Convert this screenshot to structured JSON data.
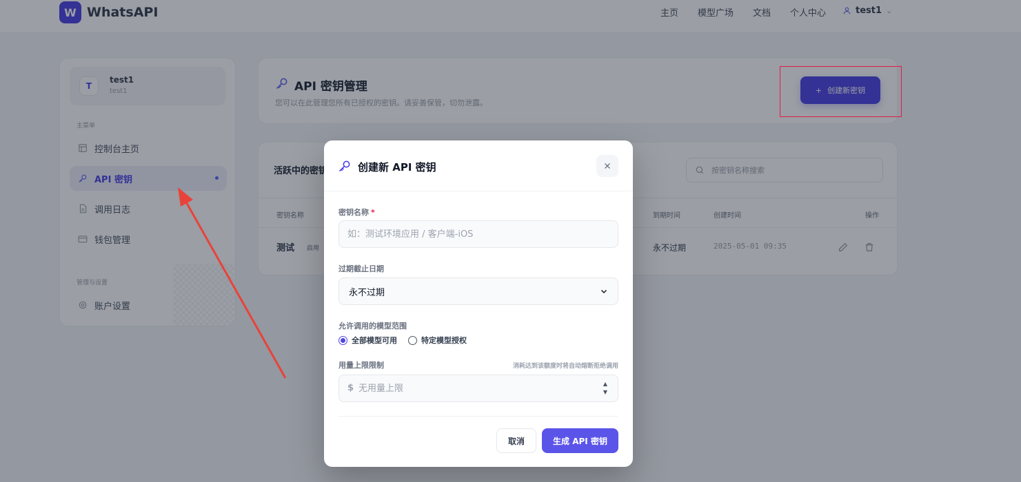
{
  "colors": {
    "accent": "#4f46e5",
    "required": "#e11d48",
    "annotation": "#e8433a"
  },
  "app": {
    "logo_letter": "W",
    "name": "WhatsAPI",
    "nav": [
      "主页",
      "模型广场",
      "文档",
      "个人中心"
    ],
    "user": "test1"
  },
  "sidebar": {
    "avatar_letter": "T",
    "user_name": "test1",
    "user_sub": "test1",
    "section_main": "主菜单",
    "items": [
      {
        "label": "控制台主页",
        "icon": "dashboard-icon"
      },
      {
        "label": "API 密钥",
        "icon": "key-icon"
      },
      {
        "label": "调用日志",
        "icon": "document-icon"
      },
      {
        "label": "钱包管理",
        "icon": "wallet-icon"
      }
    ],
    "section_settings": "管理与设置",
    "settings_item": {
      "label": "账户设置",
      "icon": "gear-icon"
    }
  },
  "header": {
    "title": "API 密钥管理",
    "subtitle": "您可以在此管理您所有已授权的密钥。请妥善保管，切勿泄露。",
    "create_button": "创建新密钥"
  },
  "table": {
    "title": "活跃中的密钥",
    "search_placeholder": "按密钥名称搜索",
    "headers": {
      "name": "密钥名称",
      "expiry": "到期时间",
      "created": "创建时间",
      "actions": "操作"
    },
    "rows": [
      {
        "name": "测试",
        "tag": "启用",
        "expiry": "永不过期",
        "created": "2025-05-01 09:35"
      }
    ]
  },
  "modal": {
    "title": "创建新 API 密钥",
    "name_label": "密钥名称",
    "required_mark": "*",
    "name_placeholder": "如：测试环境应用 / 客户端-iOS",
    "expiry_label": "过期截止日期",
    "expiry_value": "永不过期",
    "scope_label": "允许调用的模型范围",
    "scope_options": [
      {
        "label": "全部模型可用",
        "selected": true
      },
      {
        "label": "特定模型授权",
        "selected": false
      }
    ],
    "quota_label": "用量上限限制",
    "quota_hint": "消耗达到该额度时将自动熔断拒绝调用",
    "quota_prefix": "$",
    "quota_placeholder": "无用量上限",
    "cancel_label": "取消",
    "submit_label": "生成 API 密钥"
  }
}
